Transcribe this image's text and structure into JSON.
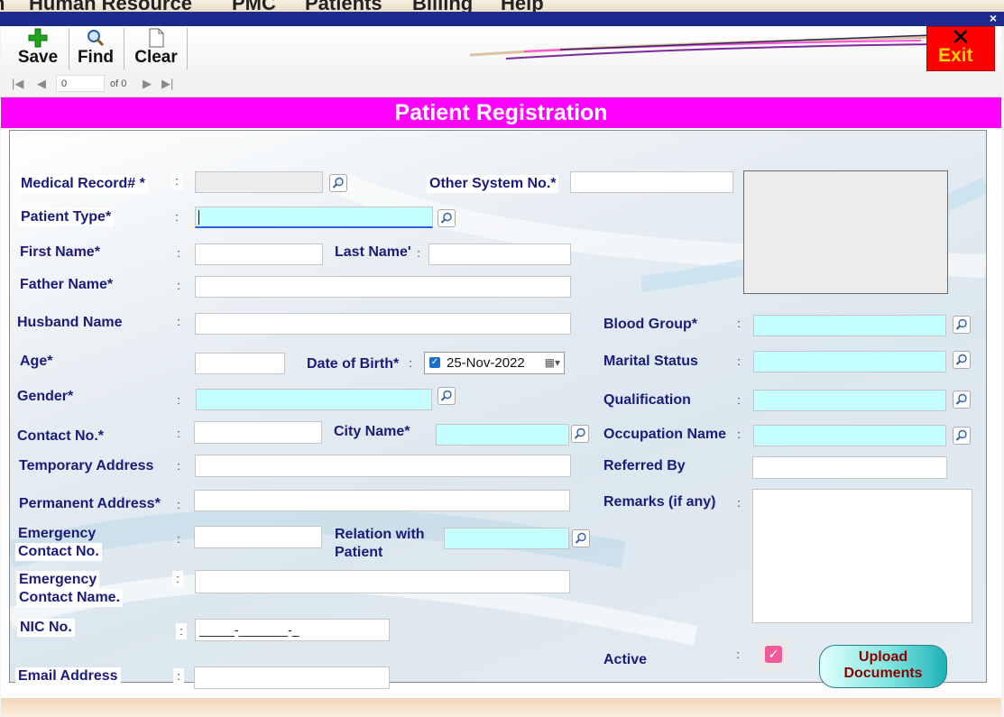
{
  "menubar": {
    "items": [
      "n",
      "Human Resource",
      "PMC",
      "Patients",
      "Billing",
      "Help"
    ]
  },
  "titlebar": {
    "close_glyph": "×"
  },
  "toolbar": {
    "save_label": "Save",
    "find_label": "Find",
    "clear_label": "Clear",
    "exit_label": "Exit",
    "exit_glyph": "✕"
  },
  "navigator": {
    "position": "0",
    "of_label": "of 0"
  },
  "form": {
    "title": "Patient Registration",
    "colon": ":",
    "medical_record_label": "Medical Record# *",
    "other_system_label": "Other System No.*",
    "patient_type_label": "Patient Type*",
    "first_name_label": "First Name*",
    "last_name_label": "Last Name'",
    "father_name_label": "Father Name*",
    "husband_name_label": "Husband Name",
    "blood_group_label": "Blood Group*",
    "age_label": "Age*",
    "dob_label": "Date of Birth*",
    "dob_value": "25-Nov-2022",
    "marital_status_label": "Marital Status",
    "gender_label": "Gender*",
    "qualification_label": "Qualification",
    "contact_label": "Contact No.*",
    "city_label": "City Name*",
    "occupation_label": "Occupation Name",
    "temp_address_label": "Temporary Address",
    "referred_by_label": "Referred By",
    "perm_address_label": "Permanent Address*",
    "remarks_label": "Remarks (if any)",
    "emergency_contact_label_1": "Emergency",
    "emergency_contact_label_2": "Contact No.",
    "relation_label_1": "Relation with",
    "relation_label_2": "Patient",
    "emergency_name_label_1": "Emergency",
    "emergency_name_label_2": "Contact Name.",
    "nic_label": "NIC No.",
    "nic_mask": "_____-_______-_",
    "active_label": "Active",
    "email_label": "Email Address",
    "upload_label_1": "Upload",
    "upload_label_2": "Documents"
  },
  "colors": {
    "banner": "#ff00ff",
    "exit_bg": "#ff0000",
    "exit_text": "#ffd700",
    "label_text": "#1b1b7a",
    "lookup_field": "#c5ffff",
    "titlebar": "#1e2a8e",
    "active_check": "#f05a9a"
  },
  "icons": {
    "save": "plus-icon",
    "find": "magnifier-icon",
    "clear": "document-icon",
    "lookup": "magnifier-icon"
  }
}
